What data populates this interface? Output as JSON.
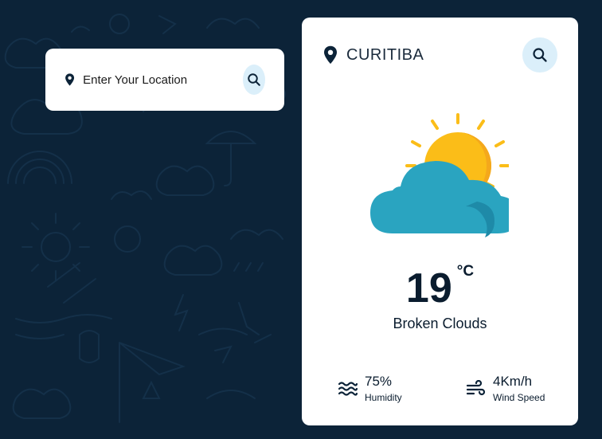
{
  "search": {
    "placeholder": "Enter Your Location"
  },
  "weather": {
    "city": "CURITIBA",
    "temperature": "19",
    "unit": "°C",
    "condition": "Broken Clouds",
    "humidity_value": "75%",
    "humidity_label": "Humidity",
    "wind_value": "4Km/h",
    "wind_label": "Wind Speed",
    "illustration": "sun-behind-cloud-icon"
  },
  "colors": {
    "background": "#0c2338",
    "card": "#ffffff",
    "accent_circle": "#dbeffa",
    "sun": "#fbbd18",
    "cloud": "#2aa4c0",
    "text": "#0a1c2e"
  }
}
